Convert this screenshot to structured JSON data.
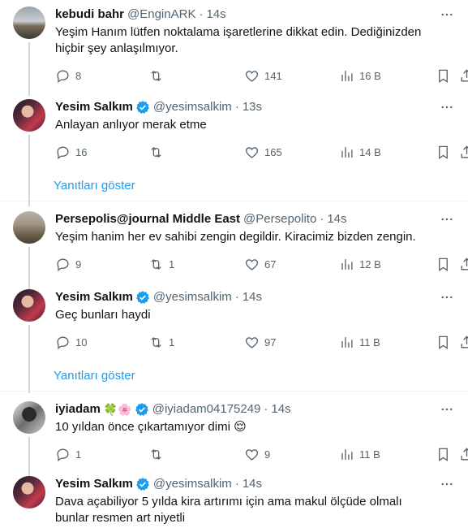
{
  "colors": {
    "accent": "#1d9bf0",
    "muted": "#536471",
    "text": "#0f1419",
    "divider": "#eff3f4"
  },
  "tweets": [
    {
      "name": "kebudi bahr",
      "handle": "@EnginARK",
      "time": "14s",
      "text": "Yeşim Hanım lütfen noktalama işaretlerine dikkat edin. Dediğinizden hiçbir şey anlaşılmıyor.",
      "reply_count": "8",
      "retweet_count": "",
      "like_count": "141",
      "view_count": "16 B"
    },
    {
      "name": "Yesim Salkım",
      "handle": "@yesimsalkim",
      "time": "13s",
      "text": "Anlayan anlıyor merak etme",
      "reply_count": "16",
      "retweet_count": "",
      "like_count": "165",
      "view_count": "14 B"
    },
    {
      "name": "Persepolis@journal Middle East",
      "handle": "@Persepolito",
      "time": "14s",
      "text": "Yeşim hanim her ev sahibi zengin degildir. Kiracimiz bizden zengin.",
      "reply_count": "9",
      "retweet_count": "1",
      "like_count": "67",
      "view_count": "12 B"
    },
    {
      "name": "Yesim Salkım",
      "handle": "@yesimsalkim",
      "time": "14s",
      "text": "Geç bunları haydi",
      "reply_count": "10",
      "retweet_count": "1",
      "like_count": "97",
      "view_count": "11 B"
    },
    {
      "name": "iyiadam",
      "name_emoji": "🍀🌸",
      "handle": "@iyiadam04175249",
      "time": "14s",
      "text": "10 yıldan önce çıkartamıyor dimi 😌",
      "reply_count": "1",
      "retweet_count": "",
      "like_count": "9",
      "view_count": "11 B"
    },
    {
      "name": "Yesim Salkım",
      "handle": "@yesimsalkim",
      "time": "14s",
      "text": "Dava açabiliyor 5 yılda kira artırımı için ama makul ölçüde olmalı bunlar resmen art niyetli"
    }
  ],
  "show_replies_label": "Yanıtları göster",
  "icons": [
    "more-icon",
    "reply-icon",
    "retweet-icon",
    "like-icon",
    "views-icon",
    "bookmark-icon",
    "share-icon",
    "verified-badge-icon"
  ]
}
